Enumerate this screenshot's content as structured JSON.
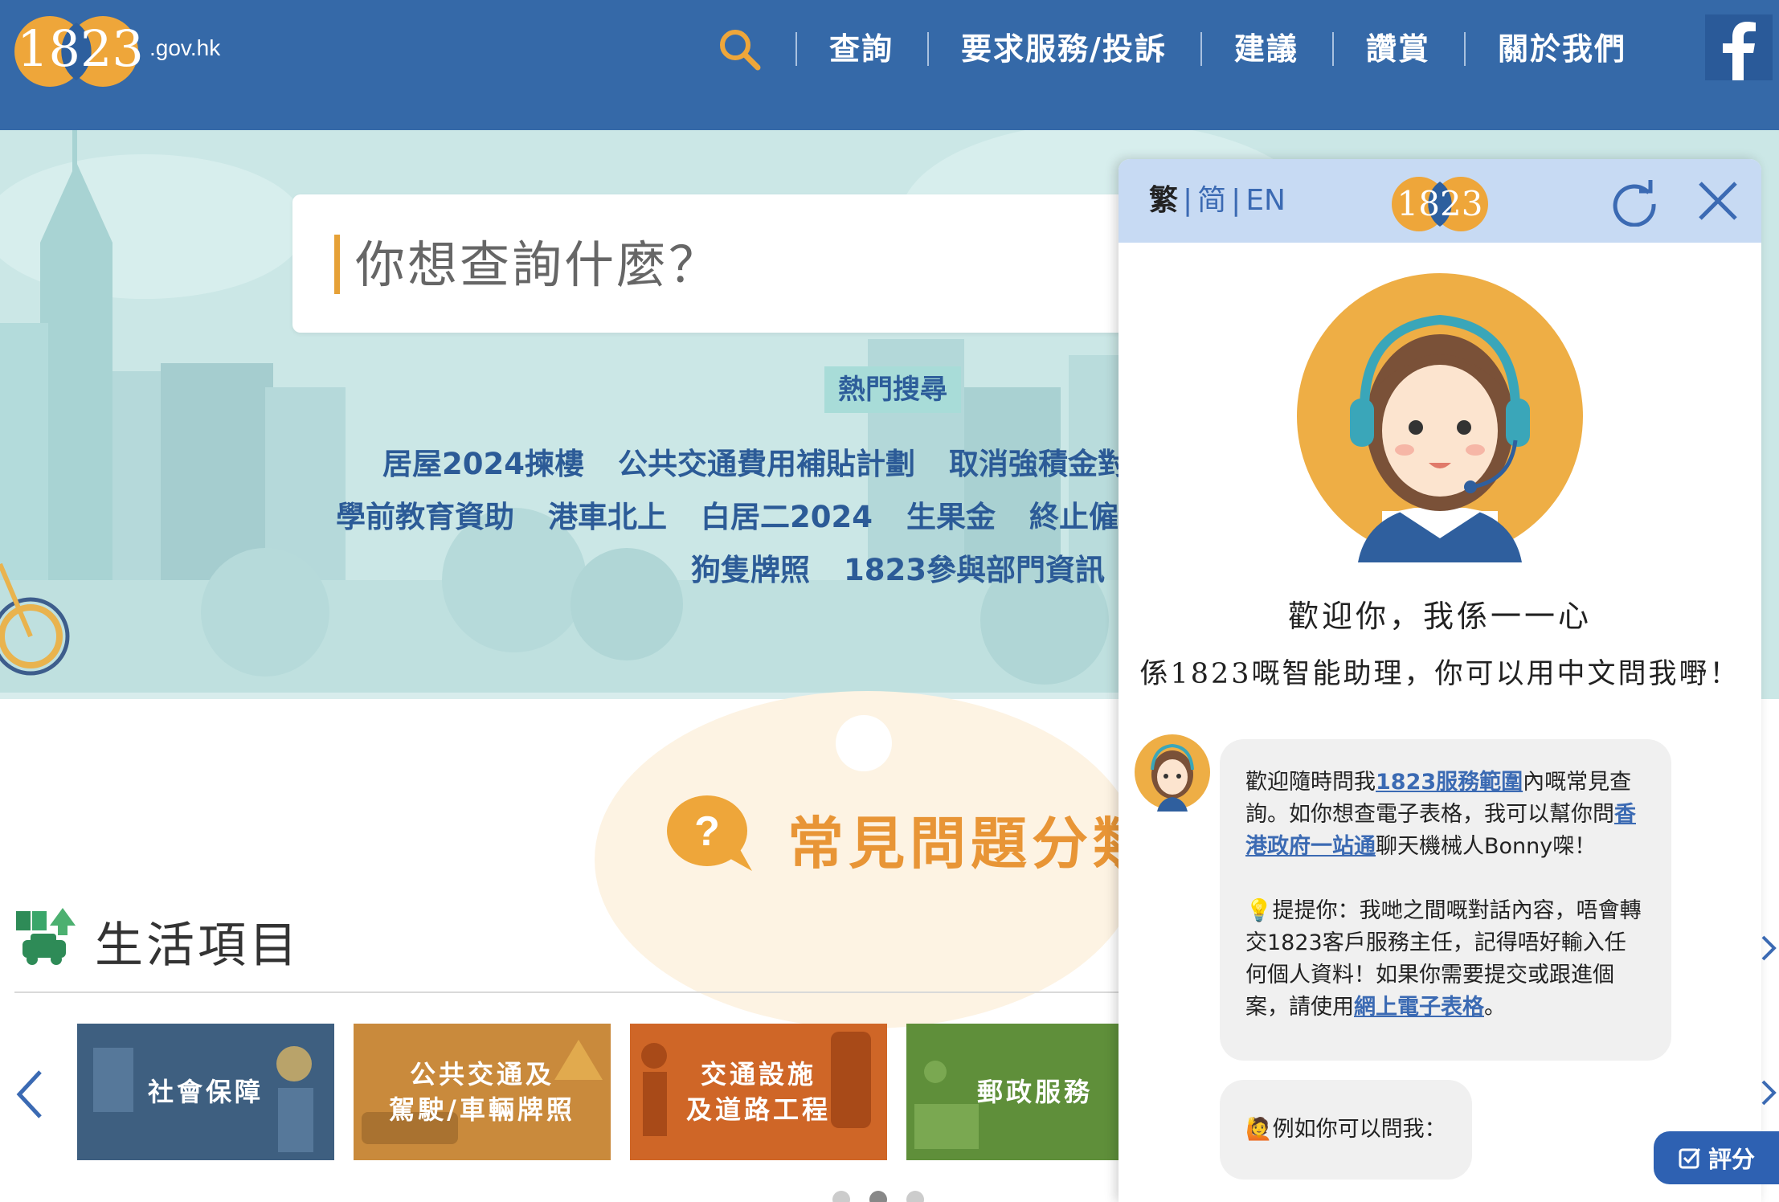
{
  "header": {
    "logo_text": "1823",
    "logo_domain": ".gov.hk",
    "nav": [
      "查詢",
      "要求服務/投訴",
      "建議",
      "讚賞",
      "關於我們"
    ],
    "facebook_label": "f"
  },
  "hero": {
    "search_placeholder": "你想查詢什麼？",
    "hot_label": "熱門搜尋",
    "hot_rows": [
      [
        "居屋2024揀樓",
        "公共交通費用補貼計劃",
        "取消強積金對"
      ],
      [
        "學前教育資助",
        "港車北上",
        "白居二2024",
        "生果金",
        "終止僱"
      ],
      [
        "狗隻牌照",
        "1823參與部門資訊"
      ]
    ]
  },
  "faq": {
    "title": "常見問題分類",
    "icon_glyph": "?"
  },
  "life": {
    "title": "生活項目",
    "cards": [
      {
        "label": "社會保障",
        "color": "#3e5f80"
      },
      {
        "label": "公共交通及\n駕駛/車輛牌照",
        "color": "#c98a3c"
      },
      {
        "label": "交通設施\n及道路工程",
        "color": "#cf6627"
      },
      {
        "label": "郵政服務",
        "color": "#5f8f3a"
      }
    ],
    "active_page_index": 1
  },
  "chat": {
    "lang_current": "繁",
    "lang_simplified": "简",
    "lang_english": "EN",
    "logo_text": "1823",
    "welcome_line1": "歡迎你，我係一一心",
    "welcome_line2": "係1823嘅智能助理，你可以用中文問我嘢！",
    "bubble1": {
      "p1_before": "歡迎隨時問我",
      "p1_link1": "1823服務範圍",
      "p1_middle": "內嘅常見查詢。如你想查電子表格，我可以幫你問",
      "p1_link2": "香港政府一站通",
      "p1_after": "聊天機械人Bonny㗎！",
      "p2_icon": "💡",
      "p2_before": "提提你：我哋之間嘅對話內容，唔會轉交1823客戶服務主任，記得唔好輸入任何個人資料！如果你需要提交或跟進個案，請使用",
      "p2_link": "網上電子表格",
      "p2_after": "。"
    },
    "bubble2": {
      "icon": "🙋",
      "text": "例如你可以問我："
    },
    "rate_label": "評分"
  },
  "colors": {
    "header_bg": "#3569a8",
    "hero_bg": "#cbe7e6",
    "accent_orange": "#e89536",
    "link_blue": "#3b6ab3",
    "chat_head_bg": "#c7daf3"
  }
}
